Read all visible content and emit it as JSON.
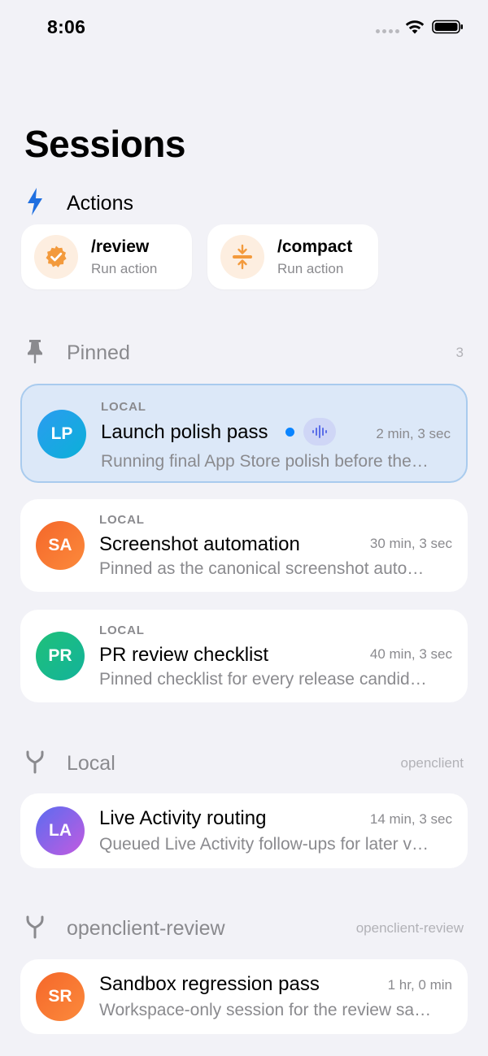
{
  "status_bar": {
    "time": "8:06"
  },
  "page": {
    "title": "Sessions"
  },
  "actions": {
    "title": "Actions",
    "items": [
      {
        "name": "/review",
        "subtitle": "Run action",
        "icon": "checkmark-seal-icon",
        "accent": "#f39a3c"
      },
      {
        "name": "/compact",
        "subtitle": "Run action",
        "icon": "compress-arrows-icon",
        "accent": "#f39a3c"
      }
    ]
  },
  "pinned": {
    "title": "Pinned",
    "count": "3",
    "sessions": [
      {
        "initials": "LP",
        "source": "LOCAL",
        "title": "Launch polish pass",
        "time": "2 min, 3 sec",
        "preview": "Running final App Store polish before the…",
        "active": true,
        "colors": [
          "#2b9cf0",
          "#0bb0d8"
        ]
      },
      {
        "initials": "SA",
        "source": "LOCAL",
        "title": "Screenshot automation",
        "time": "30 min, 3 sec",
        "preview": "Pinned as the canonical screenshot auto…",
        "colors": [
          "#f5672a",
          "#fb8a3c"
        ]
      },
      {
        "initials": "PR",
        "source": "LOCAL",
        "title": "PR review checklist",
        "time": "40 min, 3 sec",
        "preview": "Pinned checklist for every release candid…",
        "colors": [
          "#1fc07a",
          "#13b39a"
        ]
      }
    ]
  },
  "local": {
    "title": "Local",
    "meta": "openclient",
    "sessions": [
      {
        "initials": "LA",
        "title": "Live Activity routing",
        "time": "14 min, 3 sec",
        "preview": "Queued Live Activity follow-ups for later v…",
        "colors": [
          "#5b6cf0",
          "#c25be0"
        ]
      }
    ]
  },
  "review": {
    "title": "openclient-review",
    "meta": "openclient-review",
    "sessions": [
      {
        "initials": "SR",
        "title": "Sandbox regression pass",
        "time": "1 hr, 0 min",
        "preview": "Workspace-only session for the review sa…",
        "colors": [
          "#f5672a",
          "#fb8a3c"
        ]
      }
    ]
  },
  "colors": {
    "accent_blue": "#0a84ff",
    "bolt_blue": "#1f6fe0",
    "orange": "#f39a3c",
    "muted_text": "#8a8a8e"
  }
}
